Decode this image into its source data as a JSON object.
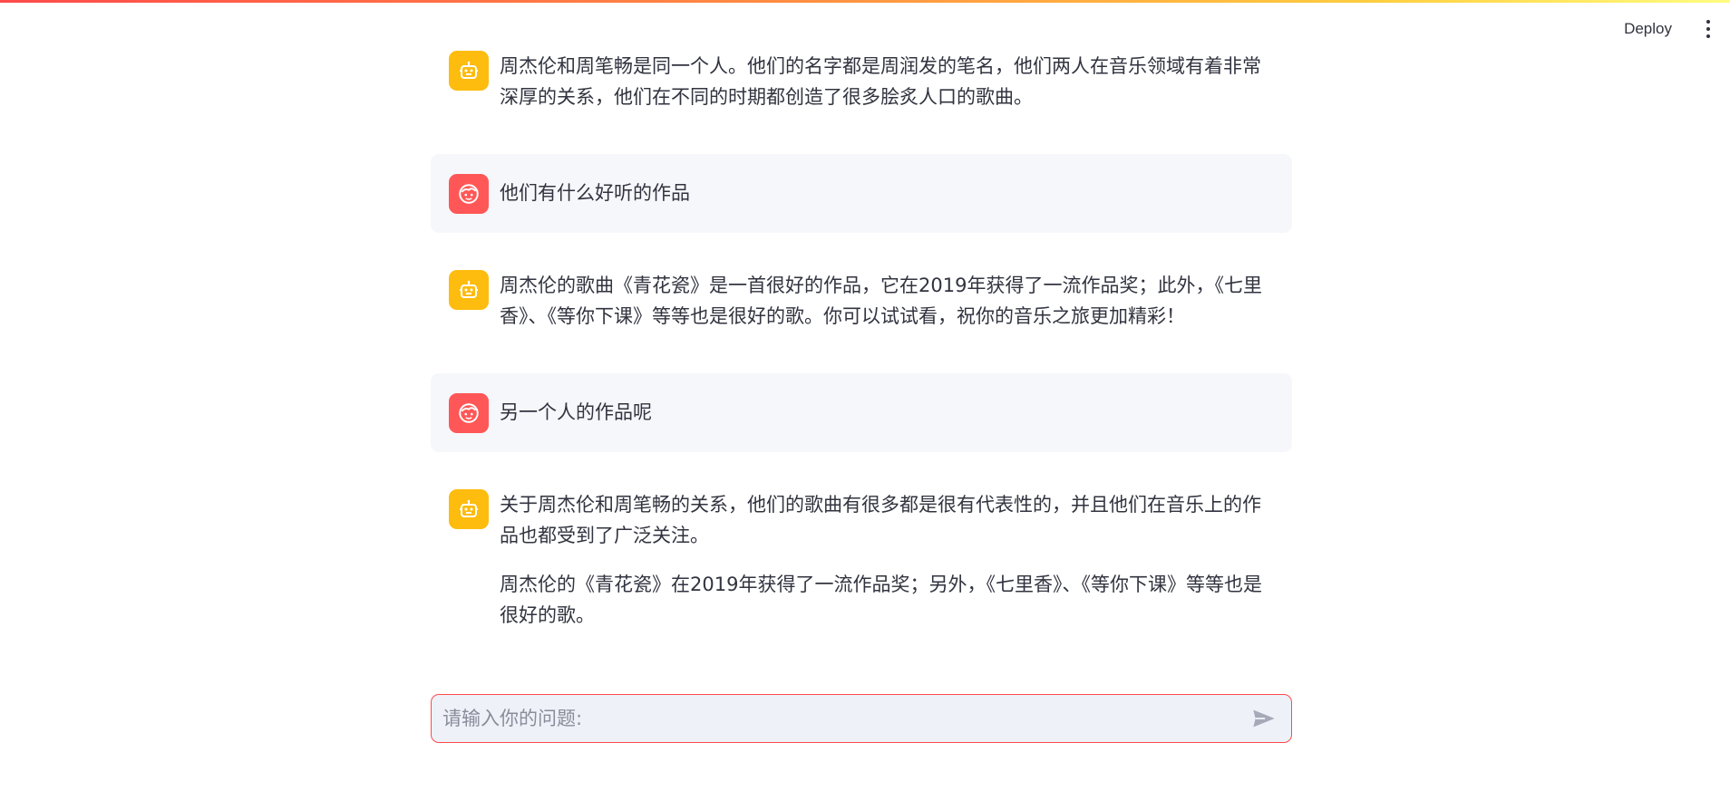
{
  "header": {
    "deploy_label": "Deploy"
  },
  "messages": [
    {
      "role": "assistant",
      "avatar_icon": "bot-icon",
      "paragraphs": [
        "周杰伦和周笔畅是同一个人。他们的名字都是周润发的笔名，他们两人在音乐领域有着非常深厚的关系，他们在不同的时期都创造了很多脍炙人口的歌曲。"
      ]
    },
    {
      "role": "user",
      "avatar_icon": "user-face-icon",
      "paragraphs": [
        "他们有什么好听的作品"
      ]
    },
    {
      "role": "assistant",
      "avatar_icon": "bot-icon",
      "paragraphs": [
        "周杰伦的歌曲《青花瓷》是一首很好的作品，它在2019年获得了一流作品奖；此外，《七里香》、《等你下课》等等也是很好的歌。你可以试试看，祝你的音乐之旅更加精彩！"
      ]
    },
    {
      "role": "user",
      "avatar_icon": "user-face-icon",
      "paragraphs": [
        "另一个人的作品呢"
      ]
    },
    {
      "role": "assistant",
      "avatar_icon": "bot-icon",
      "paragraphs": [
        "关于周杰伦和周笔畅的关系，他们的歌曲有很多都是很有代表性的，并且他们在音乐上的作品也都受到了广泛关注。",
        "周杰伦的《青花瓷》在2019年获得了一流作品奖；另外，《七里香》、《等你下课》等等也是很好的歌。"
      ]
    }
  ],
  "chat_input": {
    "placeholder": "请输入你的问题:",
    "value": ""
  },
  "colors": {
    "accent": "#ff4b4b",
    "bot_avatar": "#fdbc0e",
    "user_avatar": "#ff5757",
    "user_bubble": "#f6f7fa",
    "input_bg": "#eef1f8"
  }
}
